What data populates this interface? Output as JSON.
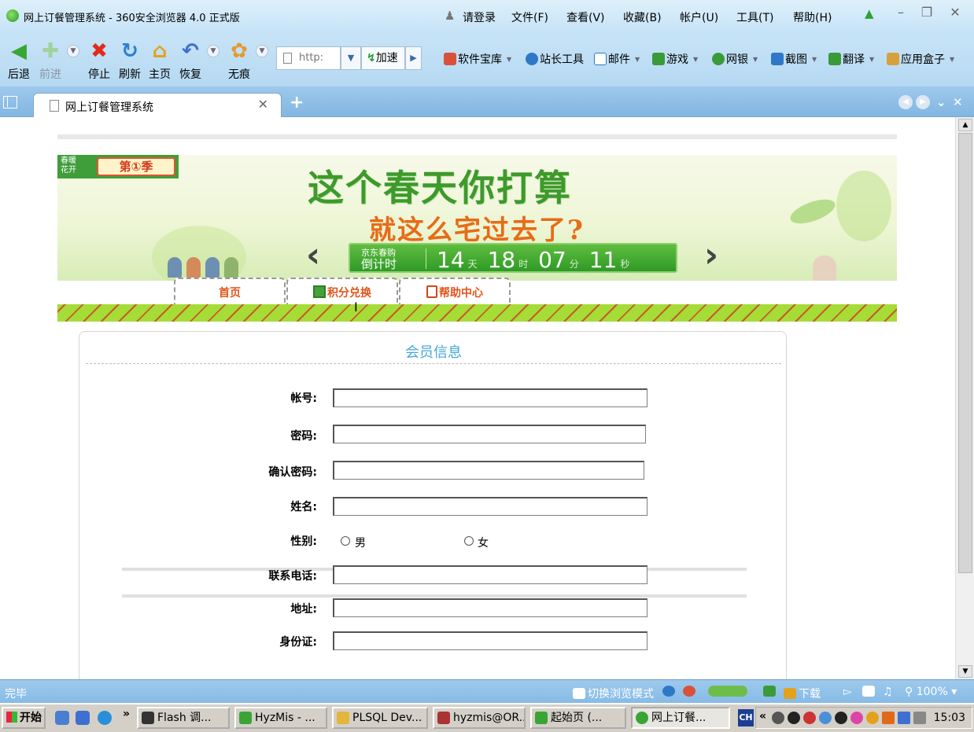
{
  "window": {
    "title": "网上订餐管理系统 - 360安全浏览器 4.0 正式版",
    "login": "请登录",
    "menus": [
      "文件(F)",
      "查看(V)",
      "收藏(B)",
      "帐户(U)",
      "工具(T)",
      "帮助(H)"
    ]
  },
  "toolbar": {
    "back": "后退",
    "forward": "前进",
    "stop": "停止",
    "refresh": "刷新",
    "home": "主页",
    "restore": "恢复",
    "incognito": "无痕",
    "address_placeholder": "http:",
    "speed": "加速",
    "links": [
      {
        "label": "软件宝库",
        "icon": "software-store-icon",
        "color": "#d8523a"
      },
      {
        "label": "站长工具",
        "icon": "webmaster-tools-icon",
        "color": "#2f78c8"
      },
      {
        "label": "邮件",
        "icon": "mail-icon",
        "color": "#2f78c8"
      },
      {
        "label": "游戏",
        "icon": "game-icon",
        "color": "#3a9a3a"
      },
      {
        "label": "网银",
        "icon": "online-bank-icon",
        "color": "#3a9a3a"
      },
      {
        "label": "截图",
        "icon": "screenshot-icon",
        "color": "#2f78c8"
      },
      {
        "label": "翻译",
        "icon": "translate-icon",
        "color": "#3a9a3a"
      },
      {
        "label": "应用盒子",
        "icon": "app-box-icon",
        "color": "#d8a03a"
      }
    ]
  },
  "tabs": [
    {
      "label": "网上订餐管理系统"
    }
  ],
  "banner": {
    "badge_top": "春暖",
    "badge_bottom": "花开",
    "badge_season": "第①季",
    "slogan_line1": "这个春天你打算",
    "slogan_line2": "就这么宅过去了?",
    "countdown_label_1": "京东春购",
    "countdown_label_2": "倒计时",
    "countdown": {
      "days": "14",
      "days_unit": "天",
      "hours": "18",
      "hours_unit": "时",
      "minutes": "07",
      "minutes_unit": "分",
      "seconds": "11",
      "seconds_unit": "秒"
    }
  },
  "nav": {
    "home": "首页",
    "points": "积分兑换",
    "help": "帮助中心"
  },
  "form": {
    "title": "会员信息",
    "fields": [
      {
        "label": "帐号:",
        "value": ""
      },
      {
        "label": "密码:",
        "value": ""
      },
      {
        "label": "确认密码:",
        "value": ""
      },
      {
        "label": "姓名:",
        "value": ""
      },
      {
        "label": "联系电话:",
        "value": ""
      },
      {
        "label": "地址:",
        "value": ""
      },
      {
        "label": "身份证:",
        "value": ""
      }
    ],
    "gender_label": "性别:",
    "gender_male": "男",
    "gender_female": "女"
  },
  "status": {
    "text": "完毕",
    "switch_mode": "切换浏览模式",
    "download": "下载",
    "zoom": "100%"
  },
  "taskbar": {
    "start": "开始",
    "tasks": [
      "Flash 调...",
      "HyzMis - ...",
      "PLSQL Dev...",
      "hyzmis@OR...",
      "起始页 (...",
      "网上订餐..."
    ],
    "ime": "CH",
    "clock": "15:03"
  }
}
